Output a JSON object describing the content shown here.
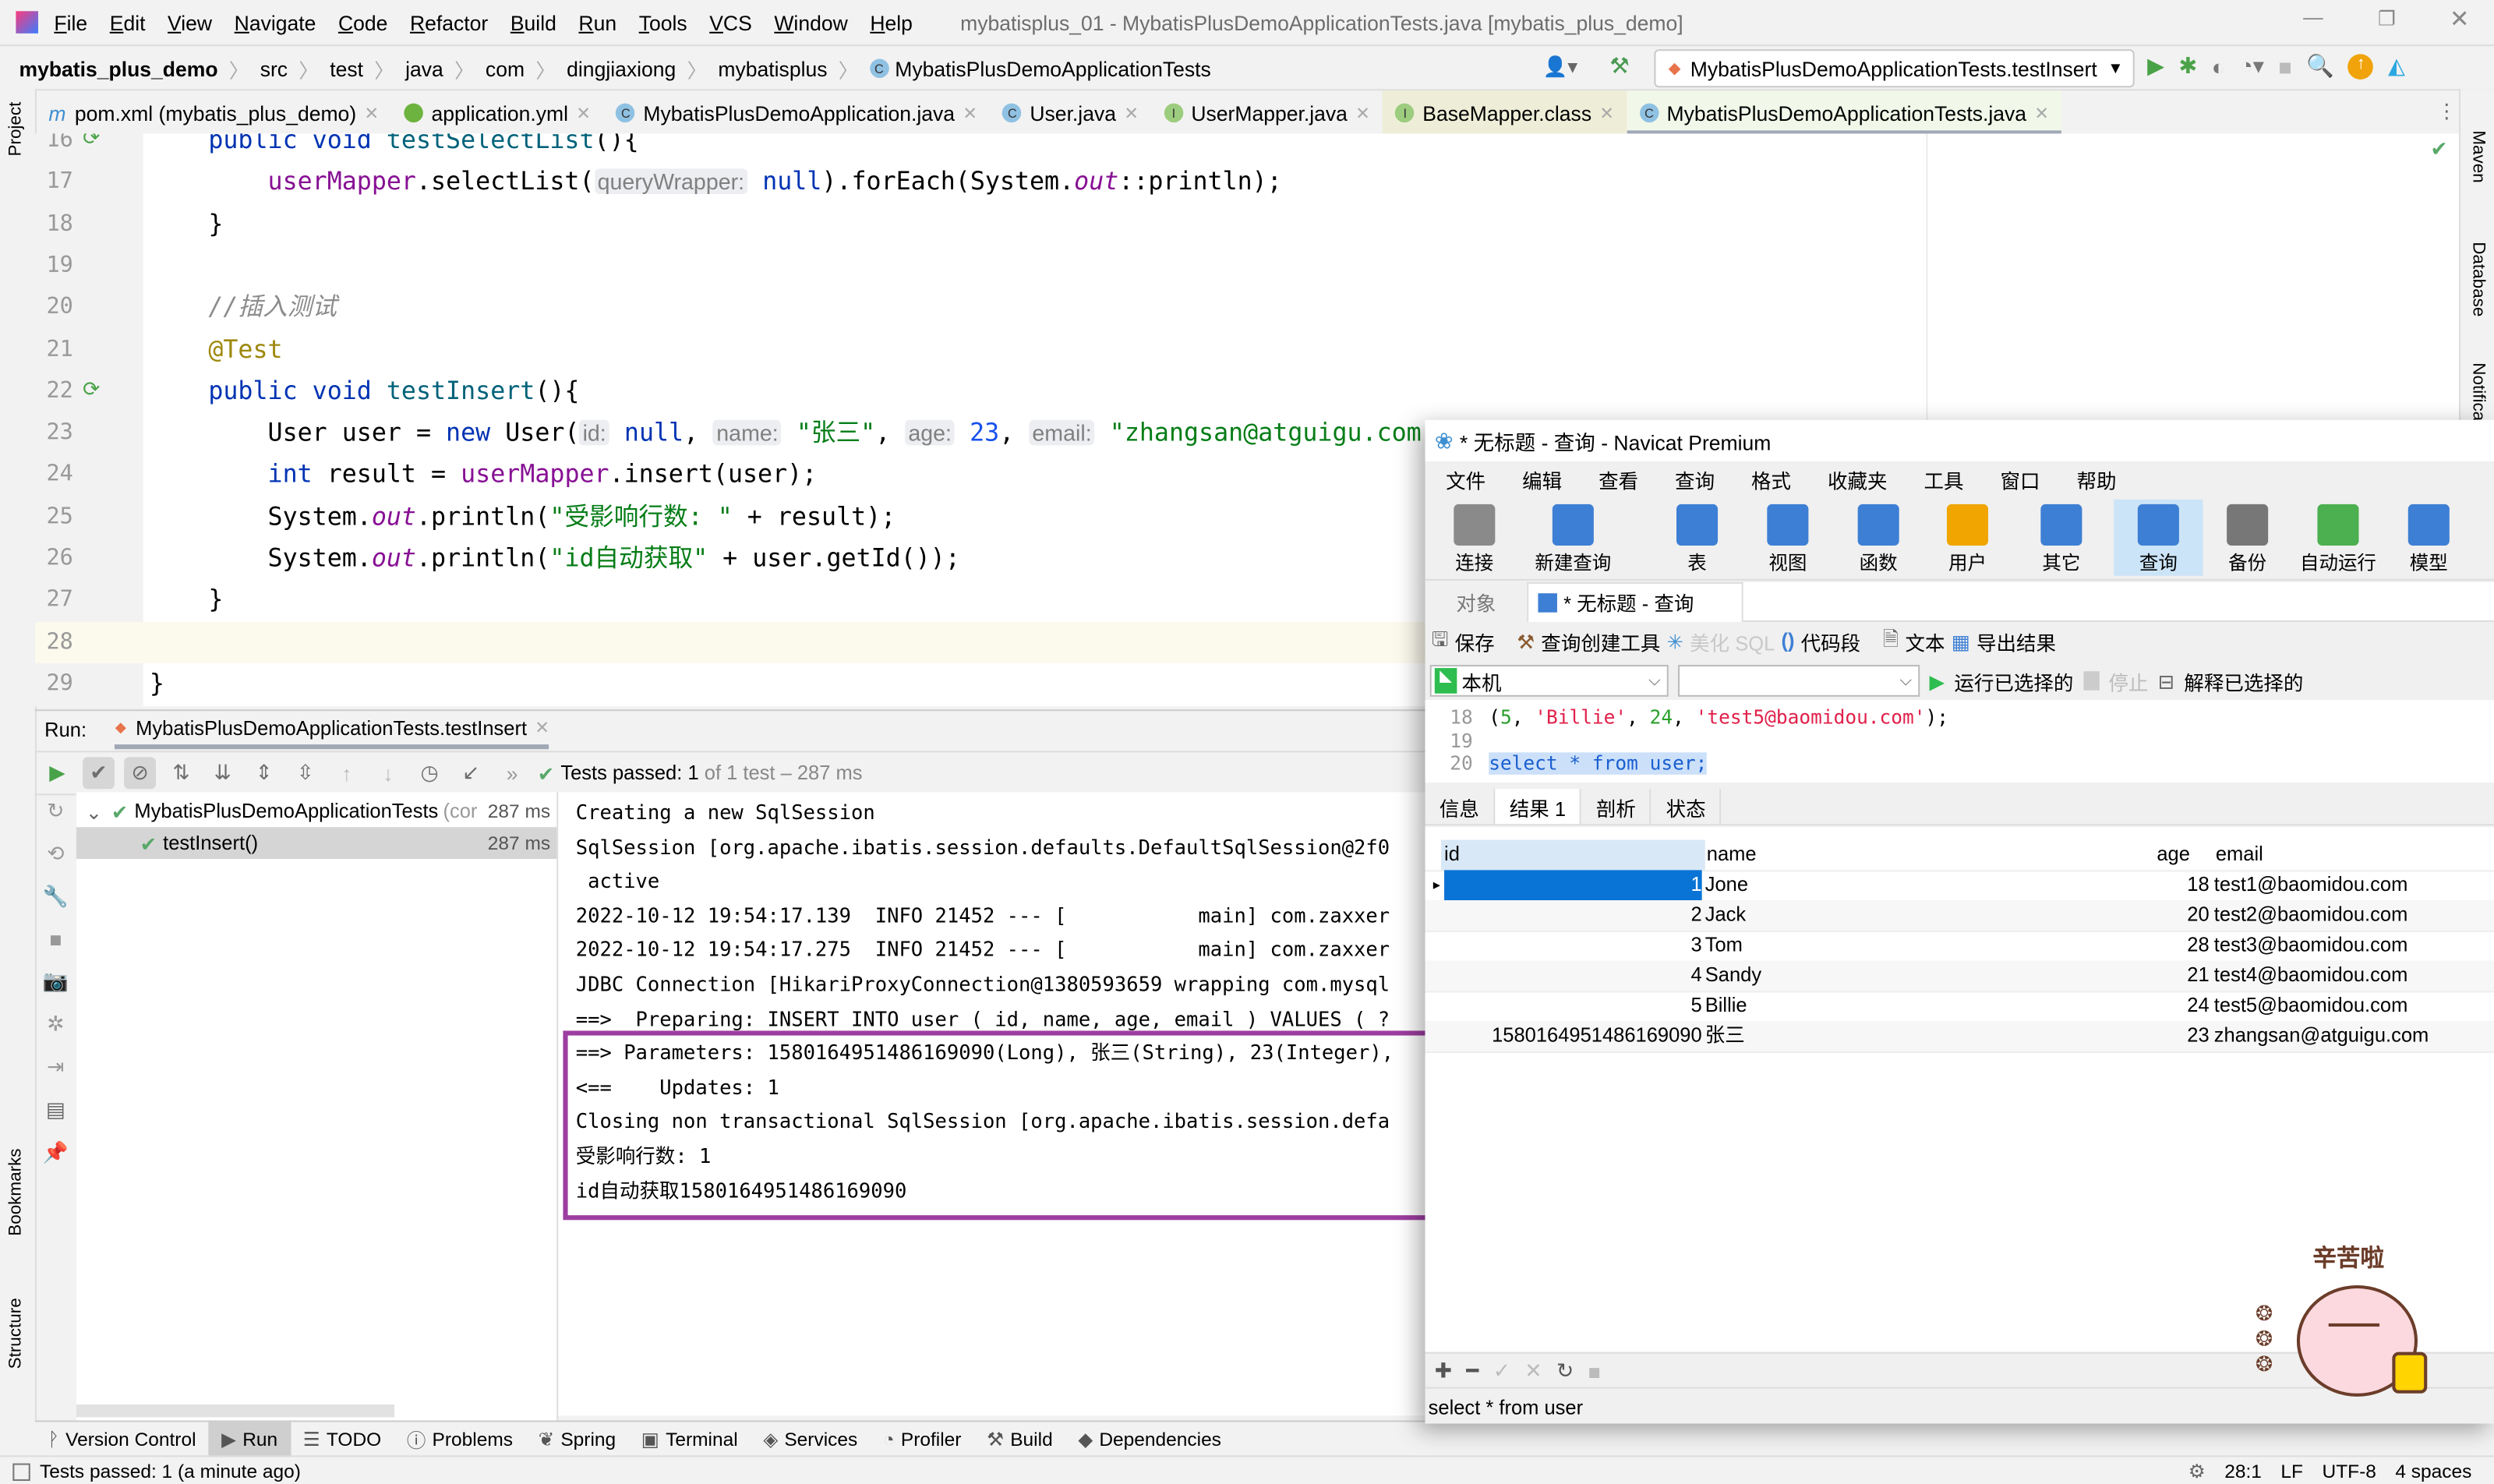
{
  "ide": {
    "menu": [
      "File",
      "Edit",
      "View",
      "Navigate",
      "Code",
      "Refactor",
      "Build",
      "Run",
      "Tools",
      "VCS",
      "Window",
      "Help"
    ],
    "window_title": "mybatisplus_01 - MybatisPlusDemoApplicationTests.java [mybatis_plus_demo]",
    "breadcrumb": [
      "mybatis_plus_demo",
      "src",
      "test",
      "java",
      "com",
      "dingjiaxiong",
      "mybatisplus",
      "MybatisPlusDemoApplicationTests"
    ],
    "run_config": "MybatisPlusDemoApplicationTests.testInsert",
    "tabs": [
      {
        "label": "pom.xml (mybatis_plus_demo)",
        "icon": "maven-icon",
        "color": "#3d8fd1"
      },
      {
        "label": "application.yml",
        "icon": "spring-icon",
        "color": "#6db33f"
      },
      {
        "label": "MybatisPlusDemoApplication.java",
        "icon": "class-icon",
        "color": "#8fc1e3"
      },
      {
        "label": "User.java",
        "icon": "class-icon",
        "color": "#8fc1e3"
      },
      {
        "label": "UserMapper.java",
        "icon": "interface-icon",
        "color": "#9ccc7e"
      },
      {
        "label": "BaseMapper.class",
        "icon": "interface-icon",
        "color": "#9ccc7e",
        "bg": "#eeeed8"
      },
      {
        "label": "MybatisPlusDemoApplicationTests.java",
        "icon": "class-icon",
        "color": "#8fc1e3",
        "bg": "#f1f8e9",
        "active": true
      }
    ],
    "left_stripe": [
      "Project",
      "Bookmarks",
      "Structure"
    ],
    "right_stripe": [
      "Maven",
      "Database",
      "Notifications"
    ],
    "code": [
      {
        "n": "16",
        "t": [
          [
            "public void ",
            "kw"
          ],
          [
            "testSelectList",
            "fn"
          ],
          [
            "(){",
            ""
          ]
        ],
        "run": true
      },
      {
        "n": "17",
        "t": [
          [
            "    ",
            ""
          ],
          [
            "userMapper",
            "fld"
          ],
          [
            ".selectList(",
            ""
          ],
          [
            "queryWrapper:",
            "hint"
          ],
          [
            " null",
            "kw"
          ],
          [
            ").forEach(System.",
            ""
          ],
          [
            "out",
            "fldi"
          ],
          [
            "::println);",
            ""
          ]
        ]
      },
      {
        "n": "18",
        "t": [
          [
            "}",
            ""
          ]
        ]
      },
      {
        "n": "19",
        "t": []
      },
      {
        "n": "20",
        "t": [
          [
            "//插入测试",
            "cmt"
          ]
        ]
      },
      {
        "n": "21",
        "t": [
          [
            "@Test",
            "ann"
          ]
        ]
      },
      {
        "n": "22",
        "t": [
          [
            "public void ",
            "kw"
          ],
          [
            "testInsert",
            "fn"
          ],
          [
            "(){",
            ""
          ]
        ],
        "run": true
      },
      {
        "n": "23",
        "t": [
          [
            "    User user = ",
            ""
          ],
          [
            "new ",
            "kw"
          ],
          [
            "User(",
            ""
          ],
          [
            "id:",
            "hint"
          ],
          [
            " null",
            "kw"
          ],
          [
            ", ",
            ""
          ],
          [
            "name:",
            "hint"
          ],
          [
            " \"张三\"",
            "str"
          ],
          [
            ", ",
            ""
          ],
          [
            "age:",
            "hint"
          ],
          [
            " 23",
            "num"
          ],
          [
            ", ",
            ""
          ],
          [
            "email:",
            "hint"
          ],
          [
            " \"zhangsan@atguigu.com\"",
            "str"
          ],
          [
            ");",
            ""
          ]
        ]
      },
      {
        "n": "24",
        "t": [
          [
            "    ",
            ""
          ],
          [
            "int ",
            "kw"
          ],
          [
            "result = ",
            ""
          ],
          [
            "userMapper",
            "fld"
          ],
          [
            ".insert(user);",
            ""
          ]
        ]
      },
      {
        "n": "25",
        "t": [
          [
            "    System.",
            ""
          ],
          [
            "out",
            "fldi"
          ],
          [
            ".println(",
            ""
          ],
          [
            "\"受影响行数: \"",
            "str"
          ],
          [
            " + result);",
            ""
          ]
        ]
      },
      {
        "n": "26",
        "t": [
          [
            "    System.",
            ""
          ],
          [
            "out",
            "fldi"
          ],
          [
            ".println(",
            ""
          ],
          [
            "\"id自动获取\"",
            "str"
          ],
          [
            " + user.getId());",
            ""
          ]
        ]
      },
      {
        "n": "27",
        "t": [
          [
            "}",
            ""
          ]
        ]
      },
      {
        "n": "28",
        "t": [],
        "current": true
      },
      {
        "n": "29",
        "t": [
          [
            "}",
            "",
            true
          ]
        ]
      }
    ],
    "run": {
      "label": "Run:",
      "tab": "MybatisPlusDemoApplicationTests.testInsert",
      "status_prefix": "Tests passed:",
      "status_count": "1",
      "status_rest": "of 1 test – 287 ms",
      "tree": [
        {
          "label": "MybatisPlusDemoApplicationTests",
          "extra": "(cor",
          "time": "287 ms"
        },
        {
          "label": "testInsert()",
          "time": "287 ms",
          "selected": true
        }
      ],
      "console": [
        "Creating a new SqlSession",
        "SqlSession [org.apache.ibatis.session.defaults.DefaultSqlSession@2f0",
        " active",
        "2022-10-12 19:54:17.139  INFO 21452 --- [           main] com.zaxxer",
        "2022-10-12 19:54:17.275  INFO 21452 --- [           main] com.zaxxer",
        "JDBC Connection [HikariProxyConnection@1380593659 wrapping com.mysql",
        "==>  Preparing: INSERT INTO user ( id, name, age, email ) VALUES ( ?",
        "==> Parameters: 1580164951486169090(Long), 张三(String), 23(Integer),",
        "<==    Updates: 1",
        "Closing non transactional SqlSession [org.apache.ibatis.session.defa",
        "受影响行数: 1",
        "id自动获取1580164951486169090"
      ]
    },
    "bottom_tools": [
      "Version Control",
      "Run",
      "TODO",
      "Problems",
      "Spring",
      "Terminal",
      "Services",
      "Profiler",
      "Build",
      "Dependencies"
    ],
    "status": {
      "message": "Tests passed: 1 (a minute ago)",
      "position": "28:1",
      "line_sep": "LF",
      "encoding": "UTF-8",
      "indent": "4 spaces"
    }
  },
  "navicat": {
    "title": "* 无标题 - 查询 - Navicat Premium",
    "menu": [
      "文件",
      "编辑",
      "查看",
      "查询",
      "格式",
      "收藏夹",
      "工具",
      "窗口",
      "帮助"
    ],
    "toolbar": [
      {
        "label": "连接",
        "icon": "connect-icon",
        "color": "#8a8a8a"
      },
      {
        "label": "新建查询",
        "icon": "new-query-icon",
        "color": "#3d7fd4"
      },
      {
        "label": "表",
        "icon": "table-icon",
        "color": "#3d7fd4"
      },
      {
        "label": "视图",
        "icon": "view-icon",
        "color": "#3d7fd4"
      },
      {
        "label": "函数",
        "icon": "function-icon",
        "color": "#3d7fd4"
      },
      {
        "label": "用户",
        "icon": "user-icon",
        "color": "#f0a500"
      },
      {
        "label": "其它",
        "icon": "other-icon",
        "color": "#3d7fd4"
      },
      {
        "label": "查询",
        "icon": "query-icon",
        "color": "#3d7fd4",
        "active": true
      },
      {
        "label": "备份",
        "icon": "backup-icon",
        "color": "#777"
      },
      {
        "label": "自动运行",
        "icon": "auto-run-icon",
        "color": "#4caf50"
      },
      {
        "label": "模型",
        "icon": "model-icon",
        "color": "#3d7fd4"
      }
    ],
    "tabs": [
      "对象",
      "* 无标题 - 查询"
    ],
    "query_toolbar": [
      "保存",
      "查询创建工具",
      "美化 SQL",
      "代码段",
      "文本",
      "导出结果"
    ],
    "connection": "本机",
    "database": "",
    "run_selected": "运行已选择的",
    "stop": "停止",
    "explain_selected": "解释已选择的",
    "sql_lines": [
      {
        "n": "18",
        "t": [
          [
            "(",
            ""
          ],
          [
            "5",
            "num"
          ],
          [
            ", ",
            ""
          ],
          [
            "'Billie'",
            "str"
          ],
          [
            ", ",
            ""
          ],
          [
            "24",
            "num"
          ],
          [
            ", ",
            ""
          ],
          [
            "'test5@baomidou.com'",
            "str"
          ],
          [
            ");",
            ""
          ]
        ]
      },
      {
        "n": "19",
        "t": []
      },
      {
        "n": "20",
        "t": [
          [
            "select * from user;",
            "kwsel"
          ]
        ]
      }
    ],
    "result_tabs": [
      "信息",
      "结果 1",
      "剖析",
      "状态"
    ],
    "columns": [
      "id",
      "name",
      "age",
      "email"
    ],
    "rows": [
      [
        "1",
        "Jone",
        "18",
        "test1@baomidou.com"
      ],
      [
        "2",
        "Jack",
        "20",
        "test2@baomidou.com"
      ],
      [
        "3",
        "Tom",
        "28",
        "test3@baomidou.com"
      ],
      [
        "4",
        "Sandy",
        "21",
        "test4@baomidou.com"
      ],
      [
        "5",
        "Billie",
        "24",
        "test5@baomidou.com"
      ],
      [
        "1580164951486169090",
        "张三",
        "23",
        "zhangsan@atguigu.com"
      ]
    ],
    "status_sql": "select * from user",
    "sticker_text": "辛苦啦"
  },
  "colors": {
    "highlight_box": "#9c3da0",
    "selection": "#0a74d6",
    "pass": "#59a869"
  }
}
